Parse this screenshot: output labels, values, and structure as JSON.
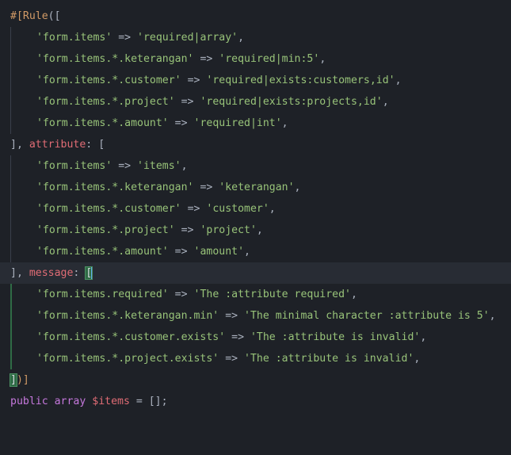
{
  "editor": {
    "line1": {
      "prefix": "#[",
      "attr": "Rule",
      "open": "(["
    },
    "rules": [
      {
        "key": "'form.items'",
        "arrow": " => ",
        "value": "'required|array'",
        "tail": ","
      },
      {
        "key": "'form.items.*.keterangan'",
        "arrow": " => ",
        "value": "'required|min:5'",
        "tail": ","
      },
      {
        "key": "'form.items.*.customer'",
        "arrow": " => ",
        "value": "'required|exists:customers,id'",
        "tail": ","
      },
      {
        "key": "'form.items.*.project'",
        "arrow": " => ",
        "value": "'required|exists:projects,id'",
        "tail": ","
      },
      {
        "key": "'form.items.*.amount'",
        "arrow": " => ",
        "value": "'required|int'",
        "tail": ","
      }
    ],
    "attribute_line": {
      "close": "], ",
      "name": "attribute",
      "colon": ": ",
      "open": "["
    },
    "attributes": [
      {
        "key": "'form.items'",
        "arrow": " => ",
        "value": "'items'",
        "tail": ","
      },
      {
        "key": "'form.items.*.keterangan'",
        "arrow": " => ",
        "value": "'keterangan'",
        "tail": ","
      },
      {
        "key": "'form.items.*.customer'",
        "arrow": " => ",
        "value": "'customer'",
        "tail": ","
      },
      {
        "key": "'form.items.*.project'",
        "arrow": " => ",
        "value": "'project'",
        "tail": ","
      },
      {
        "key": "'form.items.*.amount'",
        "arrow": " => ",
        "value": "'amount'",
        "tail": ","
      }
    ],
    "message_line": {
      "close": "], ",
      "name": "message",
      "colon": ": ",
      "open": "["
    },
    "messages": [
      {
        "key": "'form.items.required'",
        "arrow": " => ",
        "value": "'The :attribute required'",
        "tail": ","
      },
      {
        "key": "'form.items.*.keterangan.min'",
        "arrow": " => ",
        "value": "'The minimal character :attribute is 5'",
        "tail": ","
      },
      {
        "key": "'form.items.*.customer.exists'",
        "arrow": " => ",
        "value": "'The :attribute is invalid'",
        "tail": ","
      },
      {
        "key": "'form.items.*.project.exists'",
        "arrow": " => ",
        "value": "'The :attribute is invalid'",
        "tail": ","
      }
    ],
    "close_line": {
      "bracket": "]",
      "rest": ")]"
    },
    "property_line": {
      "visibility": "public",
      "type": "array",
      "var": "$items",
      "rest": " = [];"
    }
  }
}
